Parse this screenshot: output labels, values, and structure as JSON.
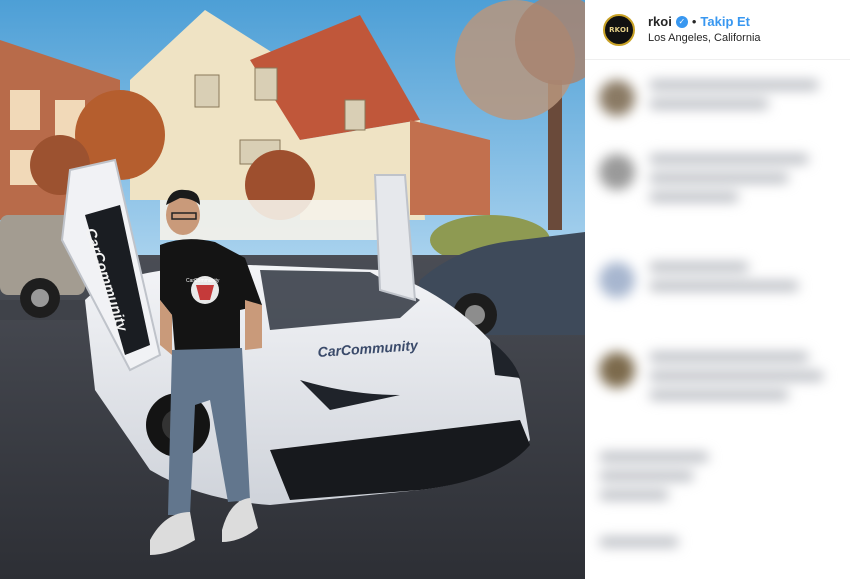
{
  "post": {
    "username": "rkoi",
    "verified_icon": "verified-badge-icon",
    "separator": "•",
    "follow_label": "Takip Et",
    "location": "Los Angeles, California",
    "avatar_text": "RKOI"
  },
  "photo": {
    "door_text": "CarCommunity",
    "hood_text": "CarCommunity",
    "shirt_text": "CarCommunity"
  },
  "colors": {
    "accent": "#3897f0",
    "text": "#262626",
    "sky": "#5aa6d6",
    "car": "#e9e9ec"
  }
}
